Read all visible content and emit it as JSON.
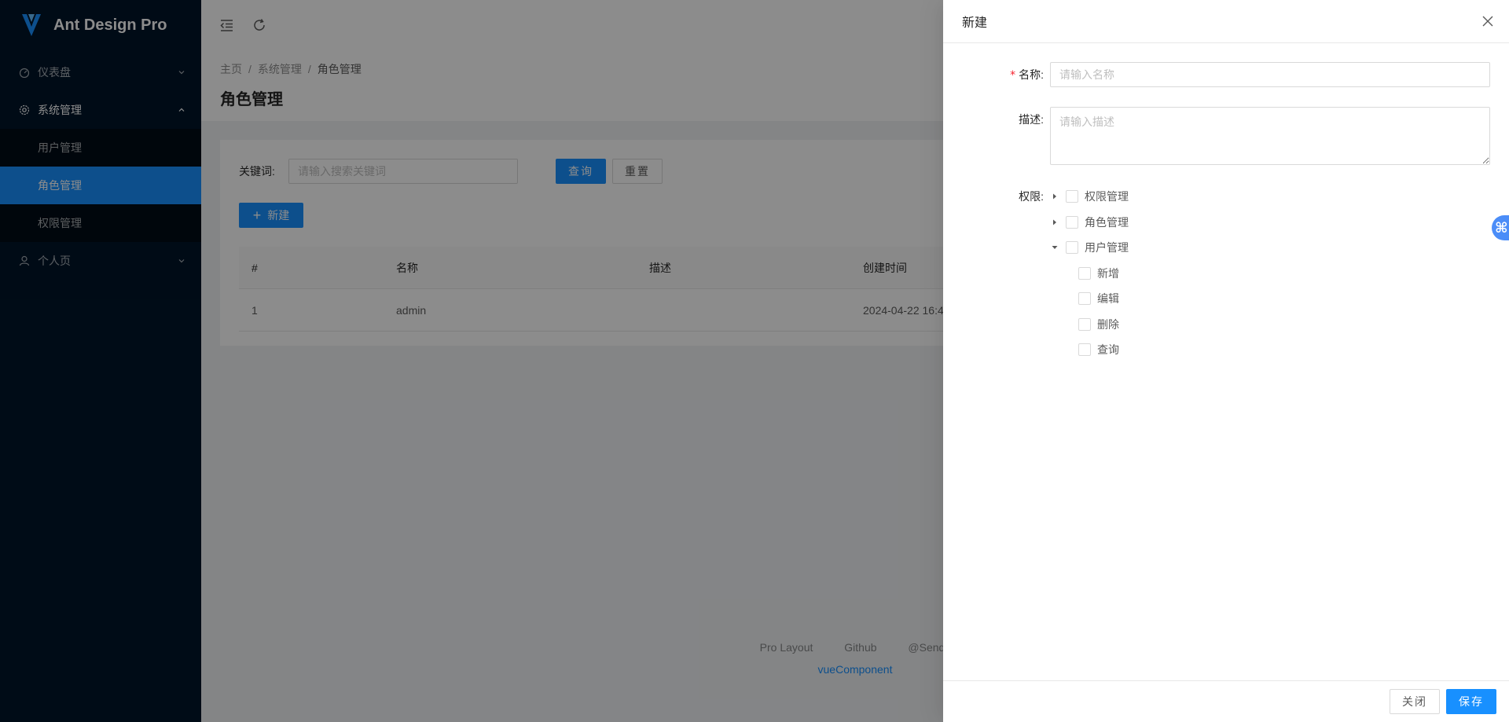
{
  "app": {
    "title": "Ant Design Pro"
  },
  "sidebar": {
    "items": [
      {
        "label": "仪表盘",
        "icon": "dashboard-icon"
      },
      {
        "label": "系统管理",
        "icon": "setting-icon"
      },
      {
        "label": "用户管理"
      },
      {
        "label": "角色管理"
      },
      {
        "label": "权限管理"
      },
      {
        "label": "个人页",
        "icon": "user-icon"
      }
    ]
  },
  "breadcrumb": {
    "items": [
      "主页",
      "系统管理",
      "角色管理"
    ],
    "separator": "/"
  },
  "page": {
    "title": "角色管理"
  },
  "search": {
    "label": "关键词:",
    "placeholder": "请输入搜索关键词",
    "query_label": "查询",
    "reset_label": "重置"
  },
  "toolbar": {
    "new_label": "新建"
  },
  "table": {
    "columns": [
      "#",
      "名称",
      "描述",
      "创建时间"
    ],
    "rows": [
      {
        "index": "1",
        "name": "admin",
        "desc": "",
        "created": "2024-04-22 16:4"
      }
    ]
  },
  "footer": {
    "links": [
      "Pro Layout",
      "Github",
      "@Sendy"
    ],
    "copyright": "vueComponent"
  },
  "drawer": {
    "title": "新建",
    "name_label": "名称:",
    "name_placeholder": "请输入名称",
    "desc_label": "描述:",
    "desc_placeholder": "请输入描述",
    "perm_label": "权限:",
    "tree": [
      {
        "label": "权限管理",
        "expanded": false
      },
      {
        "label": "角色管理",
        "expanded": false
      },
      {
        "label": "用户管理",
        "expanded": true,
        "children": [
          "新增",
          "编辑",
          "删除",
          "查询"
        ]
      }
    ],
    "close_label": "关闭",
    "save_label": "保存"
  },
  "colors": {
    "primary": "#1890ff",
    "sider": "#001529",
    "required": "#f5222d"
  }
}
